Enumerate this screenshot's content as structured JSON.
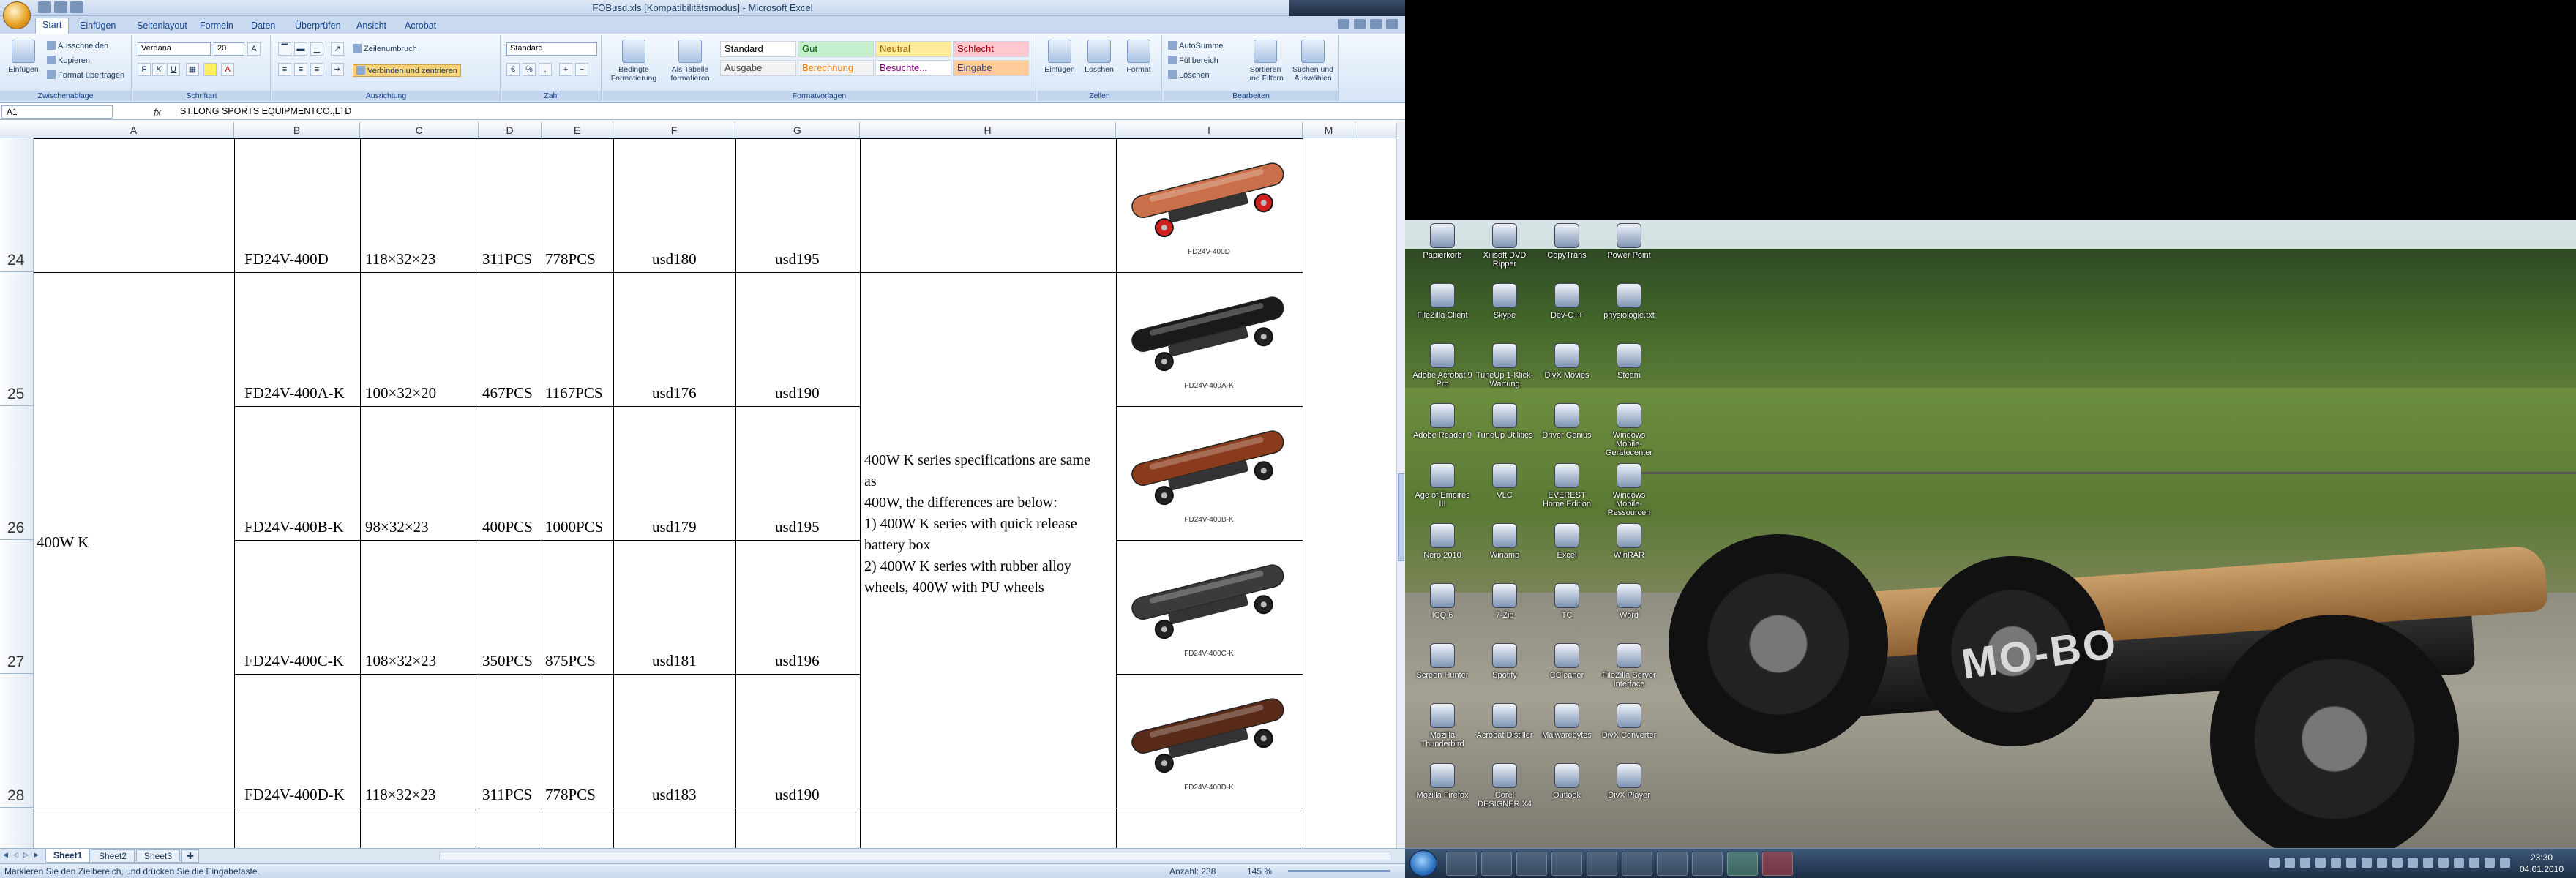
{
  "window": {
    "title": "FOBusd.xls  [Kompatibilitätsmodus] - Microsoft Excel",
    "controls": {
      "minimize": "–",
      "maximize": "□",
      "close": "✕"
    }
  },
  "ribbon": {
    "tabs": [
      "Start",
      "Einfügen",
      "Seitenlayout",
      "Formeln",
      "Daten",
      "Überprüfen",
      "Ansicht",
      "Acrobat"
    ],
    "groups": {
      "clipboard": {
        "name": "Zwischenablage",
        "paste": "Einfügen",
        "cut": "Ausschneiden",
        "copy": "Kopieren",
        "format_painter": "Format übertragen"
      },
      "font": {
        "name": "Schriftart",
        "font_family": "Verdana",
        "font_size": "20",
        "bold": "F",
        "italic": "K",
        "underline": "U"
      },
      "alignment": {
        "name": "Ausrichtung",
        "wrap": "Zeilenumbruch",
        "merge": "Verbinden und zentrieren"
      },
      "number": {
        "name": "Zahl",
        "format": "Standard"
      },
      "styles": {
        "name": "Formatvorlagen",
        "conditional": "Bedingte Formatierung",
        "as_table": "Als Tabelle formatieren",
        "cells": [
          {
            "label": "Standard",
            "bg": "#ffffff",
            "fg": "#000000"
          },
          {
            "label": "Gut",
            "bg": "#c6efce",
            "fg": "#006100"
          },
          {
            "label": "Neutral",
            "bg": "#ffeb9c",
            "fg": "#9c6500"
          },
          {
            "label": "Schlecht",
            "bg": "#ffc7ce",
            "fg": "#9c0006"
          },
          {
            "label": "Ausgabe",
            "bg": "#f2f2f2",
            "fg": "#3f3f3f"
          },
          {
            "label": "Berechnung",
            "bg": "#f2f2f2",
            "fg": "#fa7d00"
          },
          {
            "label": "Besuchte...",
            "bg": "#ffffff",
            "fg": "#800080"
          },
          {
            "label": "Eingabe",
            "bg": "#ffcc99",
            "fg": "#3f3f76"
          }
        ]
      },
      "cells": {
        "name": "Zellen",
        "insert": "Einfügen",
        "delete": "Löschen",
        "format": "Format"
      },
      "editing": {
        "name": "Bearbeiten",
        "autosum": "AutoSumme",
        "fill": "Füllbereich",
        "clear": "Löschen",
        "sort": "Sortieren und Filtern",
        "find": "Suchen und Auswählen"
      }
    }
  },
  "formula_bar": {
    "name_box": "A1",
    "fx": "fx",
    "content": "ST.LONG SPORTS EQUIPMENTCO.,LTD"
  },
  "sheet": {
    "columns": [
      "A",
      "B",
      "C",
      "D",
      "E",
      "F",
      "G",
      "H",
      "I",
      "M"
    ],
    "row_numbers": [
      "24",
      "25",
      "26",
      "27",
      "28"
    ],
    "group_label": "400W K",
    "rows": [
      {
        "model": "FD24V-400D",
        "size": "118×32×23",
        "qty1": "311PCS",
        "qty2": "778PCS",
        "price1": "usd180",
        "price2": "usd195",
        "img_label": "FD24V-400D",
        "deck": "#c9704a",
        "wheel": "#d02020"
      },
      {
        "model": "FD24V-400A-K",
        "size": "100×32×20",
        "qty1": "467PCS",
        "qty2": "1167PCS",
        "price1": "usd176",
        "price2": "usd190",
        "img_label": "FD24V-400A-K",
        "deck": "#1a1a1a",
        "wheel": "#222222"
      },
      {
        "model": "FD24V-400B-K",
        "size": "98×32×23",
        "qty1": "400PCS",
        "qty2": "1000PCS",
        "price1": "usd179",
        "price2": "usd195",
        "img_label": "FD24V-400B-K",
        "deck": "#8a3b1c",
        "wheel": "#222222"
      },
      {
        "model": "FD24V-400C-K",
        "size": "108×32×23",
        "qty1": "350PCS",
        "qty2": "875PCS",
        "price1": "usd181",
        "price2": "usd196",
        "img_label": "FD24V-400C-K",
        "deck": "#3b3b3b",
        "wheel": "#222222"
      },
      {
        "model": "FD24V-400D-K",
        "size": "118×32×23",
        "qty1": "311PCS",
        "qty2": "778PCS",
        "price1": "usd183",
        "price2": "usd190",
        "img_label": "FD24V-400D-K",
        "deck": "#5a2a18",
        "wheel": "#222222"
      }
    ],
    "note": "400W K series specifications are same as\n400W, the differences are below:\n1)  400W K series with quick release battery box\n2)  400W K series with rubber alloy wheels, 400W with PU wheels",
    "note_lines": [
      "400W K series specifications are same",
      "as",
      "400W, the differences are below:",
      "1)  400W K series with quick release",
      "battery box",
      "2)  400W K series with rubber alloy",
      "wheels, 400W with PU wheels"
    ]
  },
  "sheet_tabs": [
    "Sheet1",
    "Sheet2",
    "Sheet3"
  ],
  "status_bar": {
    "message": "Markieren Sie den Zielbereich, und drücken Sie die Eingabetaste.",
    "count": "Anzahl: 238",
    "zoom": "145 %"
  },
  "desktop": {
    "icons": [
      {
        "label": "Papierkorb"
      },
      {
        "label": "Xilisoft DVD Ripper"
      },
      {
        "label": "CopyTrans"
      },
      {
        "label": "Power Point"
      },
      {
        "label": "FileZilla Client"
      },
      {
        "label": "Skype"
      },
      {
        "label": "Dev-C++"
      },
      {
        "label": "physiologie.txt"
      },
      {
        "label": "Adobe Acrobat 9 Pro"
      },
      {
        "label": "TuneUp 1-Klick-Wartung"
      },
      {
        "label": "DivX Movies"
      },
      {
        "label": "Steam"
      },
      {
        "label": "Adobe Reader 9"
      },
      {
        "label": "TuneUp Utilities"
      },
      {
        "label": "Driver Genius"
      },
      {
        "label": "Windows Mobile-Gerätecenter"
      },
      {
        "label": "Age of Empires III"
      },
      {
        "label": "VLC"
      },
      {
        "label": "EVEREST Home Edition"
      },
      {
        "label": "Windows Mobile-Ressourcen"
      },
      {
        "label": "Nero 2010"
      },
      {
        "label": "Winamp"
      },
      {
        "label": "Excel"
      },
      {
        "label": "WinRAR"
      },
      {
        "label": "ICQ 6"
      },
      {
        "label": "7-Zip"
      },
      {
        "label": "TC"
      },
      {
        "label": "Word"
      },
      {
        "label": "Screen Hunter"
      },
      {
        "label": "Spotify"
      },
      {
        "label": "CCleaner"
      },
      {
        "label": "FileZilla Server Interface"
      },
      {
        "label": "Mozilla Thunderbird"
      },
      {
        "label": "Acrobat Distiller"
      },
      {
        "label": "Malwarebytes"
      },
      {
        "label": "DivX Converter"
      },
      {
        "label": "Mozilla Firefox"
      },
      {
        "label": "Corel DESIGNER X4"
      },
      {
        "label": "Outlook"
      },
      {
        "label": "DivX Player"
      }
    ],
    "wallpaper_brand": "MO-BO"
  },
  "taskbar": {
    "time": "23:30",
    "date": "04.01.2010"
  }
}
